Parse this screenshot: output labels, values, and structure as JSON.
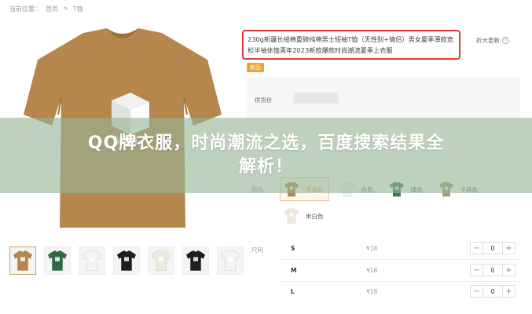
{
  "breadcrumb": {
    "prefix": "当前位置：",
    "home": "首页",
    "sep": ">",
    "current": "T恤"
  },
  "product": {
    "title": "230g新疆长绒棉重磅纯棉男士短袖T恤（无性别+情侣）男女夏季薄款宽松半袖体恤青年2023新款爆款时尚潮流夏季上衣服",
    "new_tag": "新品",
    "notify_label": "折大更新",
    "notify_icon": "help-icon",
    "price_label": "供货价"
  },
  "colors": {
    "label": "颜色",
    "options": [
      {
        "name": "卡其色",
        "hex": "#b5874c",
        "selected": true
      },
      {
        "name": "白色",
        "hex": "#f2f2f2",
        "selected": false
      },
      {
        "name": "绿色",
        "hex": "#3f7a55",
        "selected": false
      },
      {
        "name": "卡其色",
        "hex": "#a99a7b",
        "selected": false
      },
      {
        "name": "米白色",
        "hex": "#eeeadb",
        "selected": false
      }
    ]
  },
  "sizes": {
    "label": "尺码",
    "rows": [
      {
        "size": "S",
        "price": "¥18",
        "qty": "0"
      },
      {
        "size": "M",
        "price": "¥18",
        "qty": "0"
      },
      {
        "size": "L",
        "price": "¥18",
        "qty": "0"
      }
    ],
    "minus": "−",
    "plus": "+"
  },
  "thumbnails": [
    {
      "hex": "#b5874c",
      "active": true
    },
    {
      "hex": "#2f6a45",
      "active": false
    },
    {
      "hex": "#f4f4f4",
      "active": false
    },
    {
      "hex": "#1e1e1e",
      "active": false
    },
    {
      "hex": "#eeeadb",
      "active": false
    },
    {
      "hex": "#1e1e1e",
      "active": false
    },
    {
      "hex": "#f4f4f4",
      "active": false
    }
  ],
  "main_image": {
    "shirt_hex": "#b5874c",
    "icon": "tshirt-image"
  },
  "overlay": {
    "line1": "QQ牌衣服，时尚潮流之选，百度搜索结果全",
    "line2": "解析！",
    "bg_hex": "#96b496"
  },
  "accent": {
    "title_border": "#e23a36",
    "new_tag": "#f0a236",
    "selected": "#d09a5a"
  }
}
